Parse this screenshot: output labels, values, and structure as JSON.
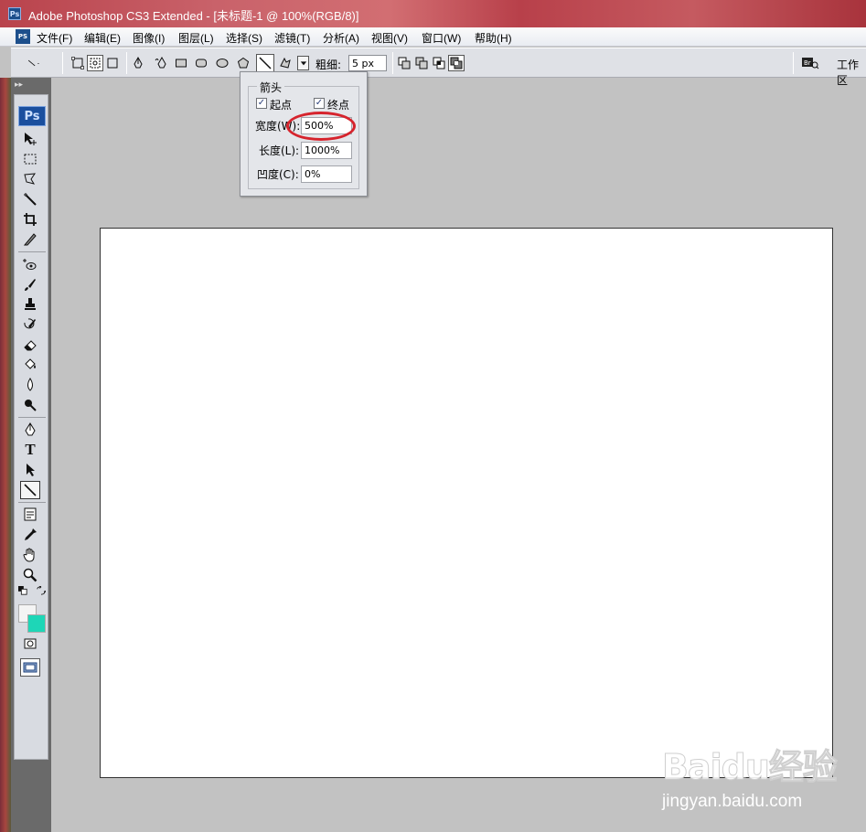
{
  "window": {
    "title": "Adobe Photoshop CS3 Extended - [未标题-1 @ 100%(RGB/8)]",
    "app_icon": "Ps"
  },
  "menubar": {
    "items": [
      "文件(F)",
      "编辑(E)",
      "图像(I)",
      "图层(L)",
      "选择(S)",
      "滤镜(T)",
      "分析(A)",
      "视图(V)",
      "窗口(W)",
      "帮助(H)"
    ]
  },
  "options_bar": {
    "weight_label": "粗细:",
    "weight_value": "5 px",
    "workspace_label": "工作区"
  },
  "toolbox": {
    "header": "▸▸",
    "badge": "Ps",
    "foreground_color": "#f4f4f4",
    "background_color": "#1ed6b7"
  },
  "arrowhead_popup": {
    "group_title": "箭头",
    "start_label": "起点",
    "start_checked": "✓",
    "end_label": "终点",
    "end_checked": "✓",
    "width_label": "宽度(W):",
    "width_value": "500%",
    "length_label": "长度(L):",
    "length_value": "1000%",
    "concavity_label": "凹度(C):",
    "concavity_value": "0%"
  },
  "watermark": {
    "logo_text": "Baidu经验",
    "url": "jingyan.baidu.com"
  }
}
